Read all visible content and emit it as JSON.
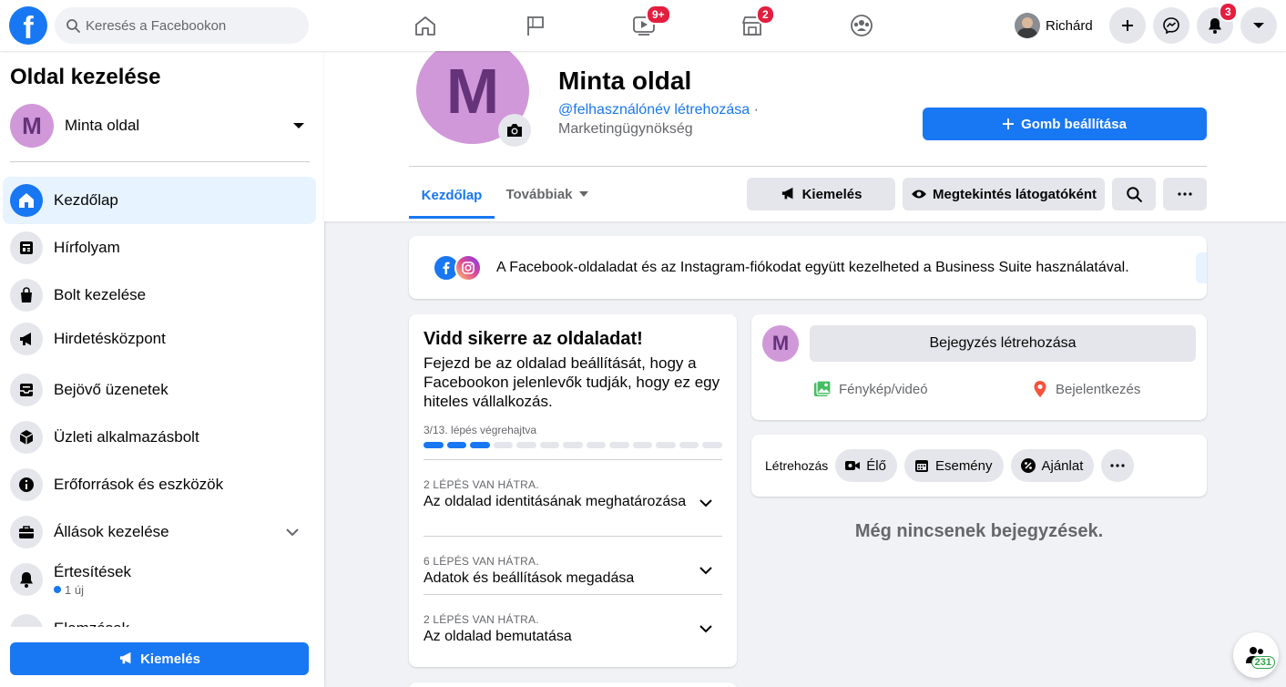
{
  "topbar": {
    "logo": "f",
    "search_placeholder": "Keresés a Facebookon",
    "nav": [
      {
        "name": "home-icon",
        "badge": ""
      },
      {
        "name": "flag-icon",
        "badge": ""
      },
      {
        "name": "watch-icon",
        "badge": "9+"
      },
      {
        "name": "marketplace-icon",
        "badge": "2"
      },
      {
        "name": "groups-icon",
        "badge": ""
      }
    ],
    "profile_name": "Richárd",
    "notifications_badge": "3",
    "accent": "#1877f2",
    "badge_color": "#e41e3f"
  },
  "sidebar": {
    "title": "Oldal kezelése",
    "page_initial": "M",
    "page_name": "Minta oldal",
    "items": [
      {
        "label": "Kezdőlap",
        "icon": "home-icon",
        "active": true
      },
      {
        "label": "Hírfolyam",
        "icon": "newsfeed-icon"
      },
      {
        "label": "Bolt kezelése",
        "icon": "shopping-bag-icon"
      },
      {
        "label": "Hirdetésközpont",
        "icon": "megaphone-icon"
      },
      {
        "label": "Bejövő üzenetek",
        "icon": "inbox-icon"
      },
      {
        "label": "Üzleti alkalmazásbolt",
        "icon": "cube-icon"
      },
      {
        "label": "Erőforrások és eszközök",
        "icon": "info-icon"
      },
      {
        "label": "Állások kezelése",
        "icon": "briefcase-icon"
      },
      {
        "label": "Értesítések",
        "icon": "bell-icon",
        "sub": "1 új"
      },
      {
        "label": "Elemzések",
        "icon": "insights-icon"
      }
    ],
    "promote_label": "Kiemelés"
  },
  "header": {
    "initial": "M",
    "page_name": "Minta oldal",
    "username_link": "@felhasználónév létrehozása",
    "separator": "·",
    "category": "Marketingügynökség",
    "setup_button": "Gomb beállítása",
    "tabs": {
      "home": "Kezdőlap",
      "more": "Továbbiak"
    },
    "actions": {
      "promote": "Kiemelés",
      "view_as_visitor": "Megtekintés látogatóként"
    }
  },
  "business_suite": {
    "text": "A Facebook-oldaladat és az Instagram-fiókodat együtt kezelheted a Business Suite használatával."
  },
  "success_card": {
    "title": "Vidd sikerre az oldaladat!",
    "description": "Fejezd be az oldalad beállítását, hogy a Facebookon jelenlevők tudják, hogy ez egy hiteles vállalkozás.",
    "progress_label": "3/13. lépés végrehajtva",
    "progress_done": 3,
    "progress_total": 13,
    "steps": [
      {
        "meta": "2 LÉPÉS VAN HÁTRA.",
        "title": "Az oldalad identitásának meghatározása"
      },
      {
        "meta": "6 LÉPÉS VAN HÁTRA.",
        "title": "Adatok és beállítások megadása"
      },
      {
        "meta": "2 LÉPÉS VAN HÁTRA.",
        "title": "Az oldalad bemutatása"
      }
    ]
  },
  "create_post": {
    "initial": "M",
    "button": "Bejegyzés létrehozása",
    "photo_video": "Fénykép/videó",
    "check_in": "Bejelentkezés"
  },
  "creation": {
    "label": "Létrehozás",
    "live": "Élő",
    "event": "Esemény",
    "offer": "Ajánlat"
  },
  "feed": {
    "empty": "Még nincsenek bejegyzések."
  },
  "chat": {
    "count": "231"
  }
}
